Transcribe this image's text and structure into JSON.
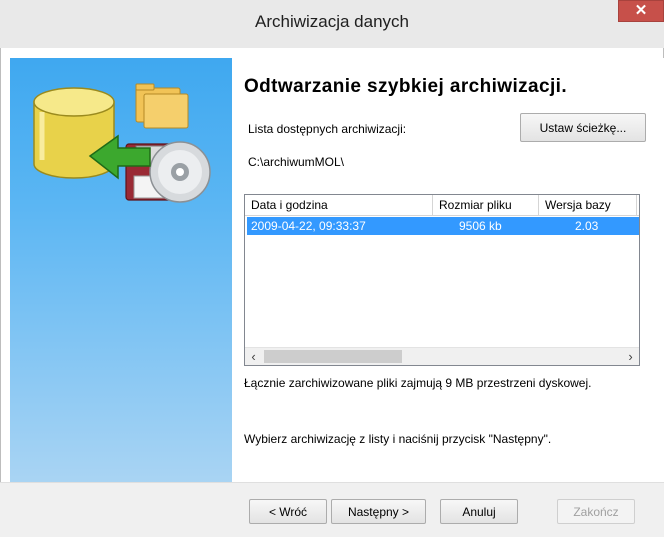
{
  "window": {
    "title": "Archiwizacja danych",
    "close_label": "✕"
  },
  "main": {
    "heading": "Odtwarzanie szybkiej archiwizacji.",
    "available_label": "Lista dostępnych archiwizacji:",
    "set_path_label": "Ustaw ścieżkę...",
    "path": "C:\\archiwumMOL\\",
    "table": {
      "columns": [
        "Data i godzina",
        "Rozmiar pliku",
        "Wersja bazy"
      ],
      "rows": [
        {
          "date": "2009-04-22, 09:33:37",
          "size": "9506 kb",
          "version": "2.03",
          "selected": true
        }
      ],
      "scroll_left": "‹",
      "scroll_right": "›"
    },
    "info_text": "Łącznie zarchiwizowane pliki zajmują 9 MB przestrzeni dyskowej.",
    "instruction_text": "Wybierz archiwizację z listy i naciśnij przycisk \"Następny\"."
  },
  "buttons": {
    "back": "< Wróć",
    "next": "Następny >",
    "cancel": "Anuluj",
    "finish": "Zakończ"
  },
  "icons": [
    "database-icon",
    "green-arrow-icon",
    "folder-icon",
    "floppy-disk-icon",
    "cd-disc-icon",
    "close-icon"
  ]
}
